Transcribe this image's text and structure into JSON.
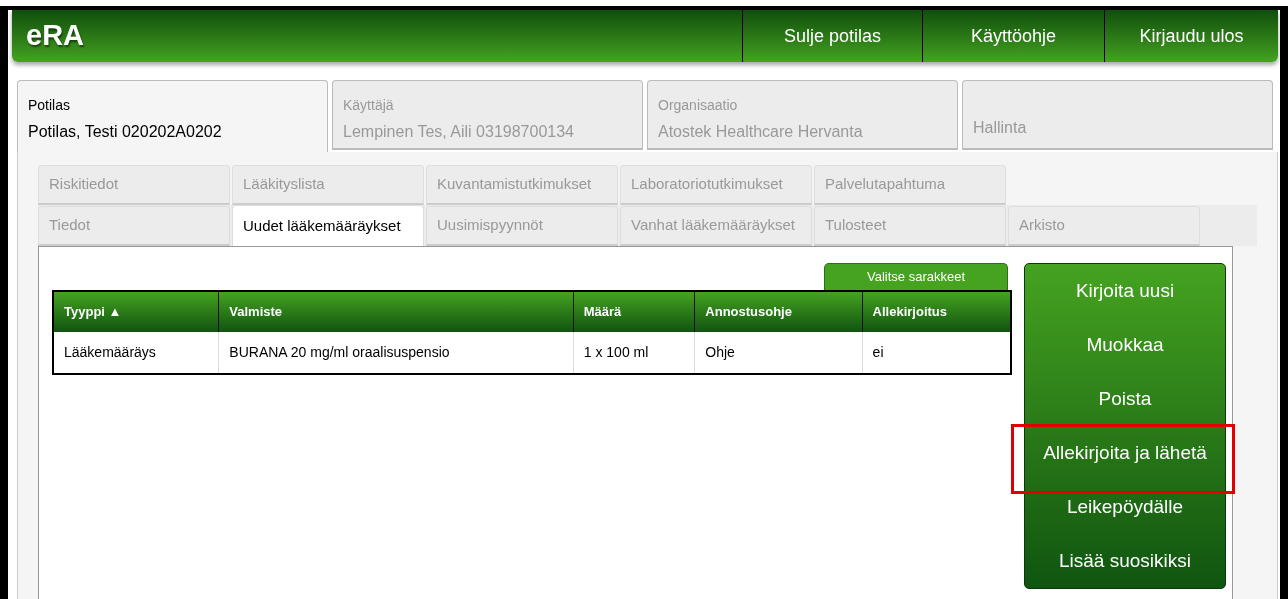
{
  "header": {
    "logo": "eRA",
    "nav": [
      "Sulje potilas",
      "Käyttöohje",
      "Kirjaudu ulos"
    ]
  },
  "context_tabs": [
    {
      "label": "Potilas",
      "value": "Potilas, Testi 020202A0202",
      "selected": true
    },
    {
      "label": "Käyttäjä",
      "value": "Lempinen Tes, Aili 03198700134",
      "selected": false
    },
    {
      "label": "Organisaatio",
      "value": "Atostek Healthcare Hervanta",
      "selected": false
    },
    {
      "value": "Hallinta",
      "selected": false
    }
  ],
  "sub_tabs": [
    [
      {
        "label": "Riskitiedot",
        "selected": false
      },
      {
        "label": "Lääkityslista",
        "selected": false
      },
      {
        "label": "Kuvantamistutkimukset",
        "selected": false
      },
      {
        "label": "Laboratoriotutkimukset",
        "selected": false
      },
      {
        "label": "Palvelutapahtuma",
        "selected": false
      }
    ],
    [
      {
        "label": "Tiedot",
        "selected": false
      },
      {
        "label": "Uudet lääkemääräykset",
        "selected": true
      },
      {
        "label": "Uusimispyynnöt",
        "selected": false
      },
      {
        "label": "Vanhat lääkemääräykset",
        "selected": false
      },
      {
        "label": "Tulosteet",
        "selected": false
      },
      {
        "label": "Arkisto",
        "selected": false
      }
    ]
  ],
  "column_picker": "Valitse sarakkeet",
  "table": {
    "columns": [
      "Tyyppi ▲",
      "Valmiste",
      "Määrä",
      "Annostusohje",
      "Allekirjoitus"
    ],
    "rows": [
      [
        "Lääkemääräys",
        "BURANA 20 mg/ml oraalisuspensio",
        "1 x 100 ml",
        "Ohje",
        "ei"
      ]
    ]
  },
  "actions": [
    {
      "label": "Kirjoita uusi",
      "highlighted": false
    },
    {
      "label": "Muokkaa",
      "highlighted": false
    },
    {
      "label": "Poista",
      "highlighted": false
    },
    {
      "label": "Allekirjoita ja lähetä",
      "highlighted": true
    },
    {
      "label": "Leikepöydälle",
      "highlighted": false
    },
    {
      "label": "Lisää suosikiksi",
      "highlighted": false
    }
  ]
}
